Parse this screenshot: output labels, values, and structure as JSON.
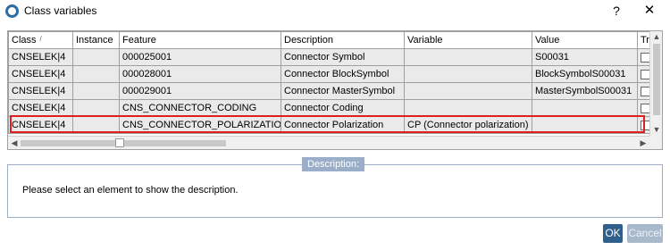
{
  "window": {
    "title": "Class variables",
    "help_label": "?",
    "close_label": "✕"
  },
  "grid": {
    "columns": [
      "Class",
      "Instance",
      "Feature",
      "Description",
      "Variable",
      "Value",
      "Tr"
    ],
    "rows": [
      {
        "class": "CNSELEK|4",
        "instance": "",
        "feature": "000025001",
        "description": "Connector Symbol",
        "variable": "",
        "value": "S00031",
        "checked": false
      },
      {
        "class": "CNSELEK|4",
        "instance": "",
        "feature": "000028001",
        "description": "Connector BlockSymbol",
        "variable": "",
        "value": "BlockSymbolS00031",
        "checked": false
      },
      {
        "class": "CNSELEK|4",
        "instance": "",
        "feature": "000029001",
        "description": "Connector MasterSymbol",
        "variable": "",
        "value": "MasterSymbolS00031",
        "checked": false
      },
      {
        "class": "CNSELEK|4",
        "instance": "",
        "feature": "CNS_CONNECTOR_CODING",
        "description": "Connector Coding",
        "variable": "",
        "value": "",
        "checked": false
      },
      {
        "class": "CNSELEK|4",
        "instance": "",
        "feature": "CNS_CONNECTOR_POLARIZATION",
        "description": "Connector Polarization",
        "variable": "CP (Connector polarization)",
        "value": "",
        "checked": false
      }
    ],
    "highlighted_row": 4,
    "highlight_color": "#e02020"
  },
  "description_panel": {
    "legend": "Description:",
    "text": "Please select an element to show the description."
  },
  "buttons": {
    "ok": "OK",
    "cancel": "Cancel"
  },
  "colors": {
    "accent": "#2f5f8a",
    "legend_bg": "#9aaec9"
  }
}
